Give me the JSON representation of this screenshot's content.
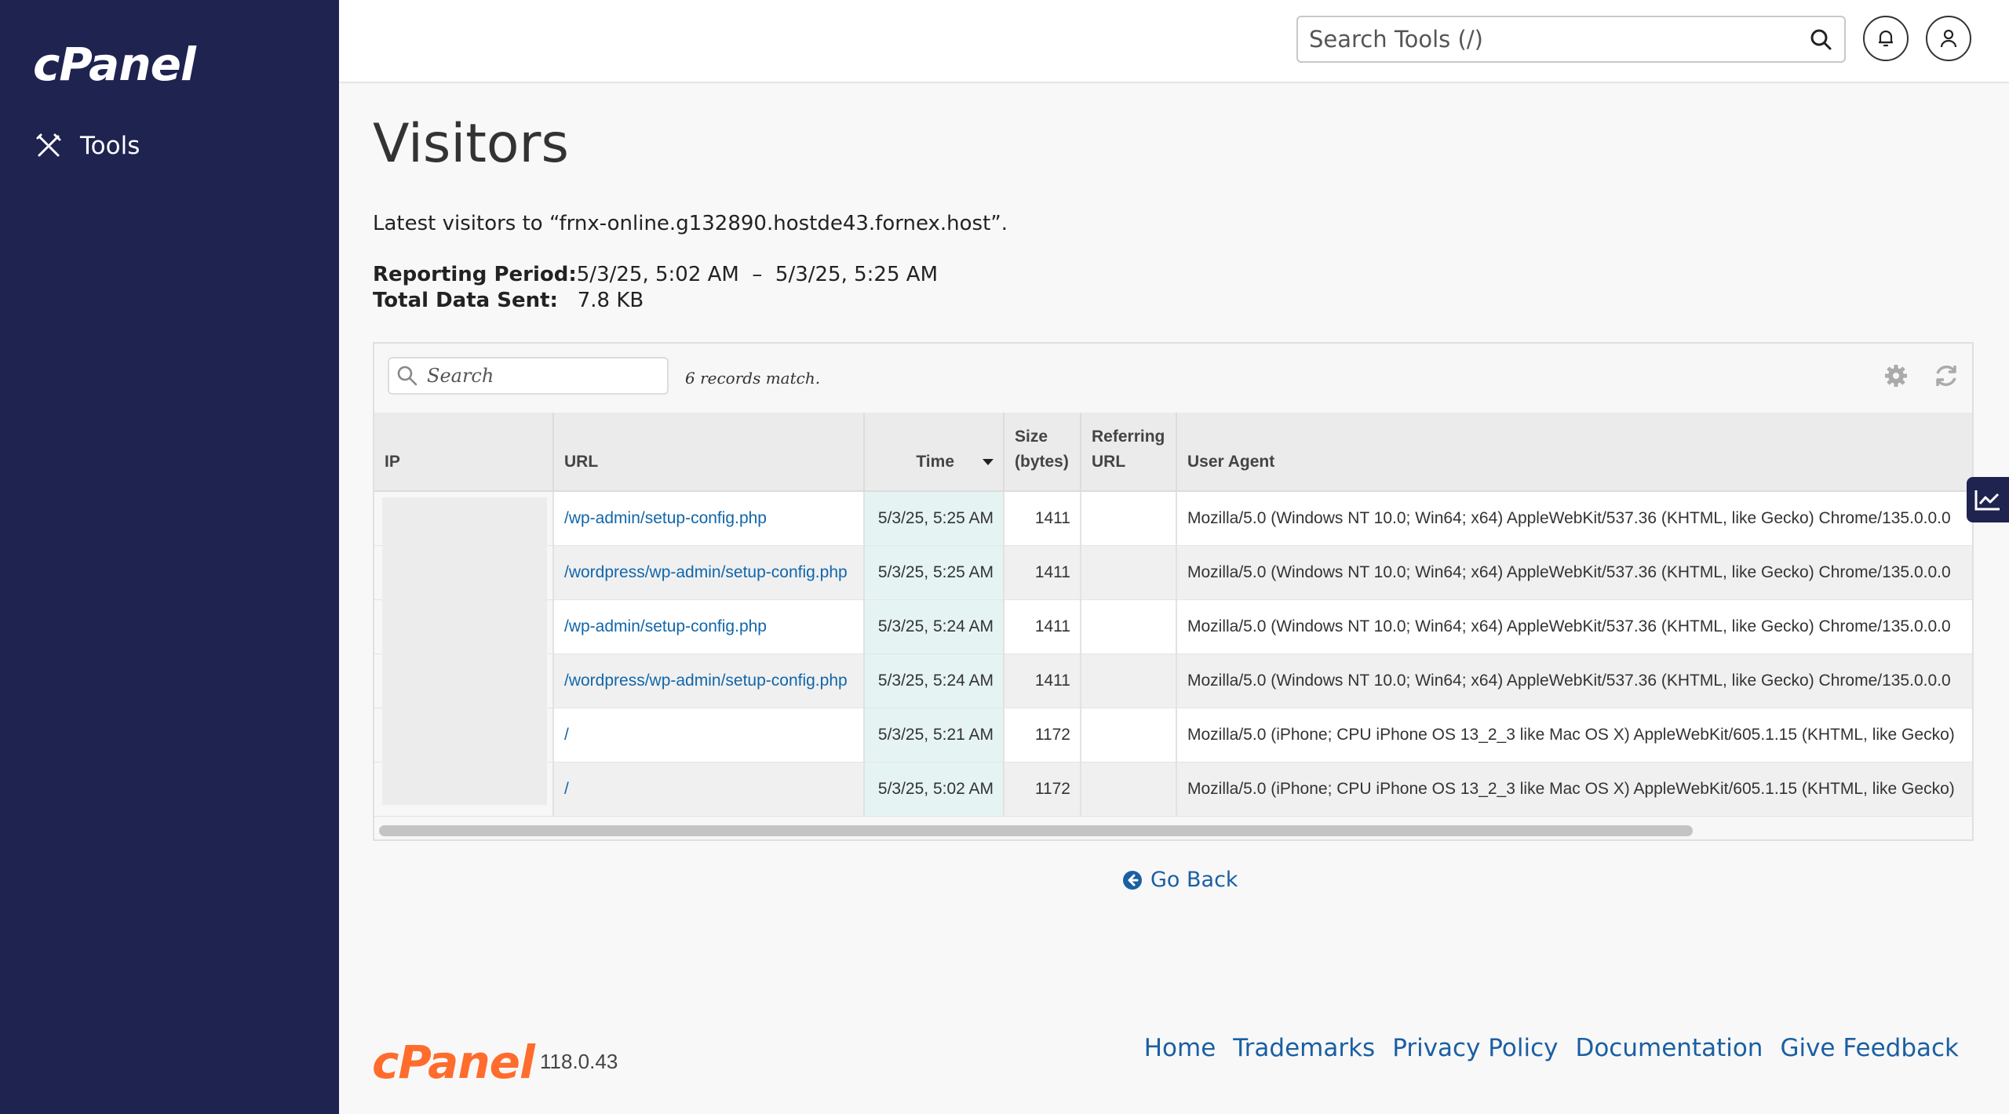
{
  "brand": {
    "logo_text": "cPanel",
    "version": "118.0.43"
  },
  "sidebar": {
    "items": [
      {
        "label": "Tools",
        "icon": "tools-icon"
      }
    ]
  },
  "topbar": {
    "search_placeholder": "Search Tools (/)"
  },
  "page": {
    "title": "Visitors",
    "intro": "Latest visitors to “frnx-online.g132890.hostde43.fornex.host”.",
    "reporting_period_label": "Reporting Period:",
    "reporting_period_value": "5/3/25, 5:02 AM  –  5/3/25, 5:25 AM",
    "total_data_label": "Total Data Sent:",
    "total_data_value": "7.8 KB"
  },
  "table": {
    "search_placeholder": "Search",
    "records_text": "6 records match.",
    "columns": [
      "IP",
      "URL",
      "Time",
      "Size (bytes)",
      "Referring URL",
      "User Agent"
    ],
    "col_size_line1": "Size",
    "col_size_line2": "(bytes)",
    "col_ref_line1": "Referring",
    "col_ref_line2": "URL",
    "rows": [
      {
        "ip": "",
        "url": "/wp-admin/setup-config.php",
        "time": "5/3/25, 5:25 AM",
        "size": "1411",
        "referrer": "",
        "agent": "Mozilla/5.0 (Windows NT 10.0; Win64; x64) AppleWebKit/537.36 (KHTML, like Gecko) Chrome/135.0.0.0"
      },
      {
        "ip": "",
        "url": "/wordpress/wp-admin/setup-config.php",
        "time": "5/3/25, 5:25 AM",
        "size": "1411",
        "referrer": "",
        "agent": "Mozilla/5.0 (Windows NT 10.0; Win64; x64) AppleWebKit/537.36 (KHTML, like Gecko) Chrome/135.0.0.0"
      },
      {
        "ip": "",
        "url": "/wp-admin/setup-config.php",
        "time": "5/3/25, 5:24 AM",
        "size": "1411",
        "referrer": "",
        "agent": "Mozilla/5.0 (Windows NT 10.0; Win64; x64) AppleWebKit/537.36 (KHTML, like Gecko) Chrome/135.0.0.0"
      },
      {
        "ip": "",
        "url": "/wordpress/wp-admin/setup-config.php",
        "time": "5/3/25, 5:24 AM",
        "size": "1411",
        "referrer": "",
        "agent": "Mozilla/5.0 (Windows NT 10.0; Win64; x64) AppleWebKit/537.36 (KHTML, like Gecko) Chrome/135.0.0.0"
      },
      {
        "ip": "",
        "url": "/",
        "time": "5/3/25, 5:21 AM",
        "size": "1172",
        "referrer": "",
        "agent": "Mozilla/5.0 (iPhone; CPU iPhone OS 13_2_3 like Mac OS X) AppleWebKit/605.1.15 (KHTML, like Gecko)"
      },
      {
        "ip": "",
        "url": "/",
        "time": "5/3/25, 5:02 AM",
        "size": "1172",
        "referrer": "",
        "agent": "Mozilla/5.0 (iPhone; CPU iPhone OS 13_2_3 like Mac OS X) AppleWebKit/605.1.15 (KHTML, like Gecko)"
      }
    ]
  },
  "go_back_label": "Go Back",
  "footer": {
    "links": [
      "Home",
      "Trademarks",
      "Privacy Policy",
      "Documentation",
      "Give Feedback"
    ]
  },
  "colors": {
    "sidebar_bg": "#1f2350",
    "link": "#1a5fa3",
    "brand_orange": "#ff6c2c"
  }
}
